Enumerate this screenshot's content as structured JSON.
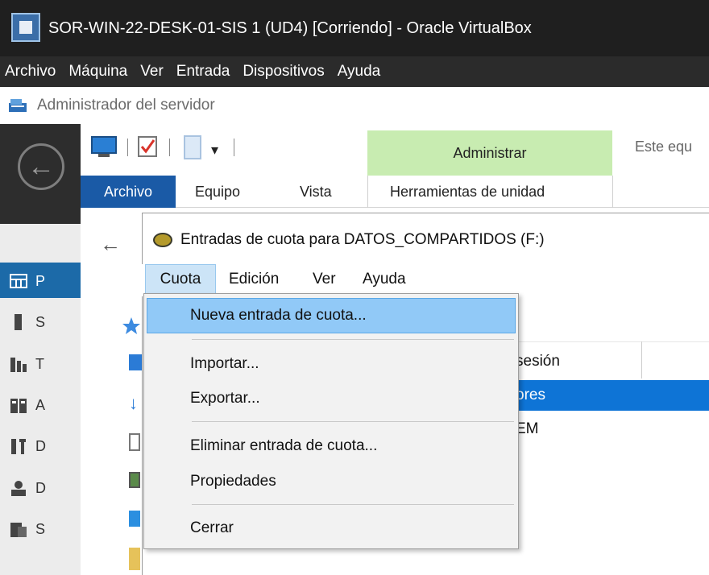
{
  "vbox": {
    "title": "SOR-WIN-22-DESK-01-SIS 1 (UD4) [Corriendo] - Oracle VirtualBox",
    "menu": [
      "Archivo",
      "Máquina",
      "Ver",
      "Entrada",
      "Dispositivos",
      "Ayuda"
    ]
  },
  "server_manager": {
    "title": "Administrador del servidor",
    "nav_letters": [
      "P",
      "S",
      "T",
      "A",
      "D",
      "D",
      "S"
    ]
  },
  "ribbon": {
    "tabs": {
      "archivo": "Archivo",
      "equipo": "Equipo",
      "vista": "Vista"
    },
    "context_header": "Administrar",
    "context_tab": "Herramientas de unidad",
    "search_partial": "Este equ"
  },
  "quota_window": {
    "title": "Entradas de cuota para DATOS_COMPARTIDOS (F:)",
    "menu": {
      "cuota": "Cuota",
      "edicion": "Edición",
      "ver": "Ver",
      "ayuda": "Ayuda"
    },
    "list": {
      "column_partial": "sesión",
      "rows_partial": [
        "ores",
        "EM"
      ]
    }
  },
  "dropdown": {
    "items": {
      "nueva": "Nueva entrada de cuota...",
      "importar": "Importar...",
      "exportar": "Exportar...",
      "eliminar": "Eliminar entrada de cuota...",
      "propiedades": "Propiedades",
      "cerrar": "Cerrar"
    }
  },
  "colors": {
    "admin_header": "#c8ecb1",
    "archivo_tab": "#1a5aa6",
    "menu_highlight": "#91c9f7",
    "selected_row": "#0e74d6"
  }
}
